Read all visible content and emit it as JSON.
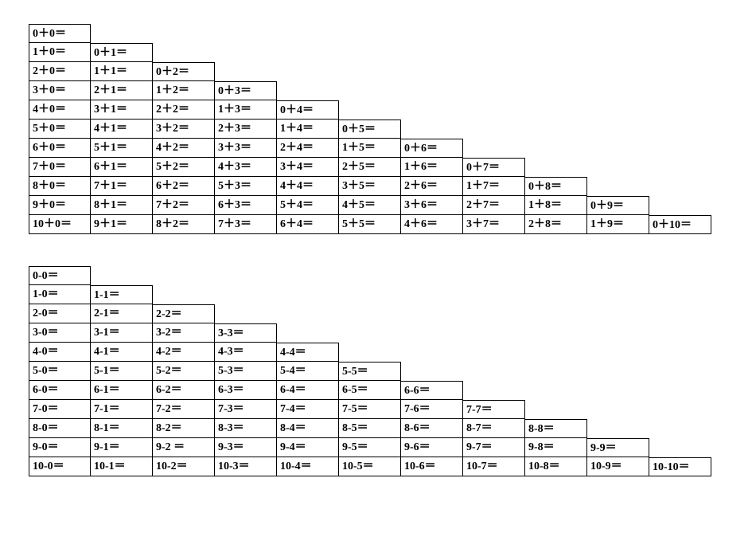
{
  "tables": [
    {
      "op": "+",
      "maxN": 10,
      "rows": [
        [
          "0＋0＝"
        ],
        [
          "1＋0＝",
          "0＋1＝"
        ],
        [
          "2＋0＝",
          "1＋1＝",
          "0＋2＝"
        ],
        [
          "3＋0＝",
          "2＋1＝",
          "1＋2＝",
          "0＋3＝"
        ],
        [
          "4＋0＝",
          "3＋1＝",
          "2＋2＝",
          "1＋3＝",
          "0＋4＝"
        ],
        [
          "5＋0＝",
          "4＋1＝",
          "3＋2＝",
          "2＋3＝",
          "1＋4＝",
          "0＋5＝"
        ],
        [
          "6＋0＝",
          "5＋1＝",
          "4＋2＝",
          "3＋3＝",
          "2＋4＝",
          "1＋5＝",
          "0＋6＝"
        ],
        [
          "7＋0＝",
          "6＋1＝",
          "5＋2＝",
          "4＋3＝",
          "3＋4＝",
          "2＋5＝",
          "1＋6＝",
          "0＋7＝"
        ],
        [
          "8＋0＝",
          "7＋1＝",
          "6＋2＝",
          "5＋3＝",
          "4＋4＝",
          "3＋5＝",
          "2＋6＝",
          "1＋7＝",
          "0＋8＝"
        ],
        [
          "9＋0＝",
          "8＋1＝",
          "7＋2＝",
          "6＋3＝",
          "5＋4＝",
          "4＋5＝",
          "3＋6＝",
          "2＋7＝",
          "1＋8＝",
          "0＋9＝"
        ],
        [
          "10＋0＝",
          "9＋1＝",
          "8＋2＝",
          "7＋3＝",
          "6＋4＝",
          "5＋5＝",
          "4＋6＝",
          "3＋7＝",
          "2＋8＝",
          "1＋9＝",
          "0＋10＝"
        ]
      ]
    },
    {
      "op": "-",
      "maxN": 10,
      "rows": [
        [
          "0-0＝"
        ],
        [
          "1-0＝",
          "1-1＝"
        ],
        [
          "2-0＝",
          "2-1＝",
          "2-2＝"
        ],
        [
          "3-0＝",
          "3-1＝",
          "3-2＝",
          "3-3＝"
        ],
        [
          "4-0＝",
          "4-1＝",
          "4-2＝",
          "4-3＝",
          "4-4＝"
        ],
        [
          "5-0＝",
          "5-1＝",
          "5-2＝",
          "5-3＝",
          "5-4＝",
          "5-5＝"
        ],
        [
          "6-0＝",
          "6-1＝",
          "6-2＝",
          "6-3＝",
          "6-4＝",
          "6-5＝",
          "6-6＝"
        ],
        [
          "7-0＝",
          "7-1＝",
          "7-2＝",
          "7-3＝",
          "7-4＝",
          "7-5＝",
          "7-6＝",
          "7-7＝"
        ],
        [
          "8-0＝",
          "8-1＝",
          "8-2＝",
          "8-3＝",
          "8-4＝",
          "8-5＝",
          "8-6＝",
          "8-7＝",
          "8-8＝"
        ],
        [
          "9-0＝",
          "9-1＝",
          "9-2 ＝",
          "9-3＝",
          "9-4＝",
          "9-5＝",
          "9-6＝",
          "9-7＝",
          "9-8＝",
          "9-9＝"
        ],
        [
          "10-0＝",
          "10-1＝",
          "10-2＝",
          "10-3＝",
          "10-4＝",
          "10-5＝",
          "10-6＝",
          "10-7＝",
          "10-8＝",
          "10-9＝",
          "10-10＝"
        ]
      ]
    }
  ]
}
